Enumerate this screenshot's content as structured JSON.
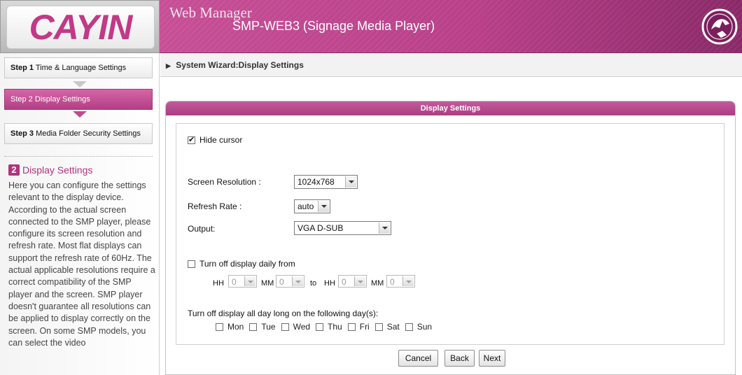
{
  "header": {
    "logo_text": "CAYIN",
    "app_title": "Web Manager",
    "app_subtitle": "SMP-WEB3 (Signage Media Player)",
    "brand_color": "#c03a86"
  },
  "sidebar": {
    "steps": [
      {
        "num": "Step 1",
        "label": "Time & Language Settings",
        "active": false
      },
      {
        "num": "Step 2",
        "label": "Display Settings",
        "active": true
      },
      {
        "num": "Step 3",
        "label": "Media Folder Security Settings",
        "active": false
      }
    ],
    "help": {
      "badge": "2",
      "title": "Display Settings",
      "text": "Here you can configure the settings relevant to the display device. According to the actual screen connected to the SMP player, please configure its screen resolution and refresh rate. Most flat displays can support the refresh rate of 60Hz. The actual applicable resolutions require a correct compatibility of the SMP player and the screen. SMP player doesn't guarantee all resolutions can be applied to display correctly on the screen. On some SMP models, you can select the video"
    }
  },
  "breadcrumb": "System Wizard:Display Settings",
  "panel": {
    "title": "Display Settings",
    "hide_cursor": {
      "label": "Hide cursor",
      "checked": true
    },
    "screen_resolution": {
      "label": "Screen Resolution :",
      "value": "1024x768"
    },
    "refresh_rate": {
      "label": "Refresh Rate :",
      "value": "auto"
    },
    "output": {
      "label": "Output:",
      "value": "VGA D-SUB"
    },
    "turn_off_daily": {
      "label": "Turn off display daily from",
      "checked": false,
      "hh_label": "HH",
      "mm_label": "MM",
      "to_label": "to",
      "from_hh": "0",
      "from_mm": "0",
      "to_hh": "0",
      "to_mm": "0"
    },
    "turn_off_days_label": "Turn off display all day long on the following day(s):",
    "days": [
      "Mon",
      "Tue",
      "Wed",
      "Thu",
      "Fri",
      "Sat",
      "Sun"
    ]
  },
  "buttons": {
    "cancel": "Cancel",
    "back": "Back",
    "next": "Next"
  }
}
